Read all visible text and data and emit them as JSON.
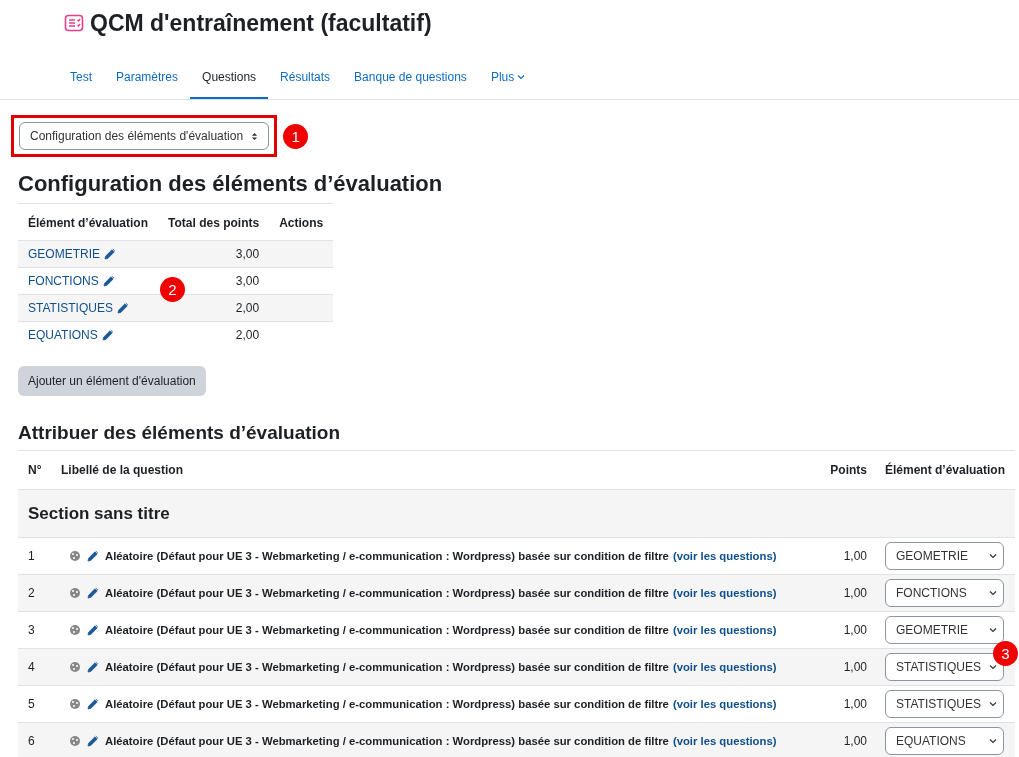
{
  "page_title": "QCM d'entraînement (facultatif)",
  "tabs": [
    {
      "label": "Test",
      "selected": false
    },
    {
      "label": "Paramètres",
      "selected": false
    },
    {
      "label": "Questions",
      "selected": true
    },
    {
      "label": "Résultats",
      "selected": false
    },
    {
      "label": "Banque de questions",
      "selected": false
    },
    {
      "label": "Plus",
      "selected": false
    }
  ],
  "view_select": {
    "value": "Configuration des éléments d'évaluation",
    "highlighted": true,
    "callout": "1"
  },
  "config": {
    "heading": "Configuration des éléments d’évaluation",
    "callout": "2",
    "columns": [
      "Élément d’évaluation",
      "Total des points",
      "Actions"
    ],
    "rows": [
      {
        "name": "GEOMETRIE",
        "total": "3,00"
      },
      {
        "name": "FONCTIONS",
        "total": "3,00"
      },
      {
        "name": "STATISTIQUES",
        "total": "2,00"
      },
      {
        "name": "EQUATIONS",
        "total": "2,00"
      }
    ],
    "add_button": "Ajouter un élément d'évaluation"
  },
  "assign": {
    "heading": "Attribuer des éléments d’évaluation",
    "columns": [
      "N°",
      "Libellé de la question",
      "Points",
      "Élément d’évaluation"
    ],
    "section": "Section sans titre",
    "rows": [
      {
        "number": "1",
        "label": "Aléatoire (Défaut pour UE 3 - Webmarketing / e-communication : Wordpress) basée sur condition de filtre",
        "link": "(voir les questions)",
        "points": "1,00",
        "element": "GEOMETRIE"
      },
      {
        "number": "2",
        "label": "Aléatoire (Défaut pour UE 3 - Webmarketing / e-communication : Wordpress) basée sur condition de filtre",
        "link": "(voir les questions)",
        "points": "1,00",
        "element": "FONCTIONS"
      },
      {
        "number": "3",
        "label": "Aléatoire (Défaut pour UE 3 - Webmarketing / e-communication : Wordpress) basée sur condition de filtre",
        "link": "(voir les questions)",
        "points": "1,00",
        "element": "GEOMETRIE"
      },
      {
        "number": "4",
        "label": "Aléatoire (Défaut pour UE 3 - Webmarketing / e-communication : Wordpress) basée sur condition de filtre",
        "link": "(voir les questions)",
        "points": "1,00",
        "element": "STATISTIQUES",
        "callout": "3"
      },
      {
        "number": "5",
        "label": "Aléatoire (Défaut pour UE 3 - Webmarketing / e-communication : Wordpress) basée sur condition de filtre",
        "link": "(voir les questions)",
        "points": "1,00",
        "element": "STATISTIQUES"
      },
      {
        "number": "6",
        "label": "Aléatoire (Défaut pour UE 3 - Webmarketing / e-communication : Wordpress) basée sur condition de filtre",
        "link": "(voir les questions)",
        "points": "1,00",
        "element": "EQUATIONS"
      }
    ]
  }
}
